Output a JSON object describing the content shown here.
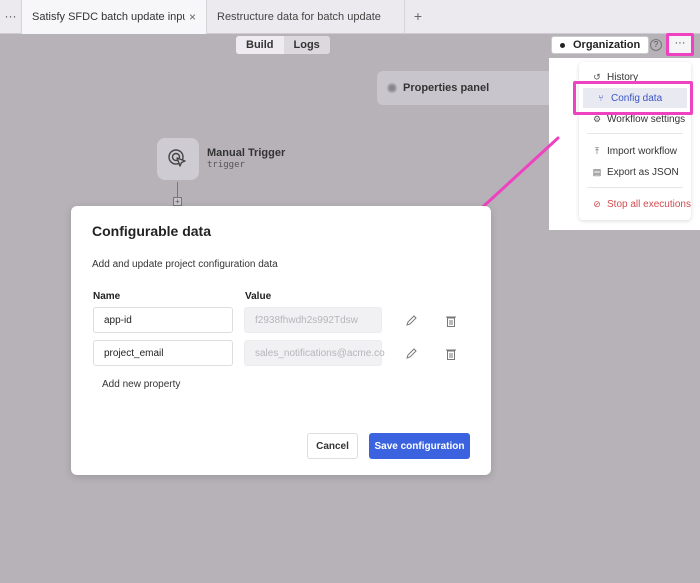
{
  "tabs": {
    "overflow_label": "···",
    "active_label": "Satisfy SFDC batch update input sch",
    "active_close": "×",
    "second_label": "Restructure data for batch update",
    "add_label": "+"
  },
  "view_toggle": {
    "build_label": "Build",
    "logs_label": "Logs",
    "selected": "Build"
  },
  "header": {
    "org_label": "Organization",
    "help_icon": "?",
    "more_label": "···"
  },
  "canvas": {
    "properties_label": "Properties panel",
    "trigger_title": "Manual Trigger",
    "trigger_subtitle": "trigger",
    "add_step": "+"
  },
  "menu": {
    "items": [
      {
        "label": "History",
        "icon": "↺"
      },
      {
        "label": "Config data",
        "icon": "⑂"
      },
      {
        "label": "Workflow settings",
        "icon": "⚙"
      },
      {
        "label": "Import workflow",
        "icon": "⤒"
      },
      {
        "label": "Export as JSON",
        "icon": "▤"
      },
      {
        "label": "Stop all executions",
        "icon": "⊘"
      }
    ],
    "highlighted": "Config data"
  },
  "annotation": {
    "color": "#ee42c1"
  },
  "modal": {
    "title": "Configurable data",
    "subtitle": "Add and update project configuration data",
    "col_name": "Name",
    "col_value": "Value",
    "rows": [
      {
        "name": "app-id",
        "value": "f2938fhwdh2s992Tdsw"
      },
      {
        "name": "project_email",
        "value": "sales_notifications@acme.co"
      }
    ],
    "add_label": "Add new property",
    "cancel_label": "Cancel",
    "save_label": "Save configuration",
    "accent_color": "#3b63e0"
  }
}
